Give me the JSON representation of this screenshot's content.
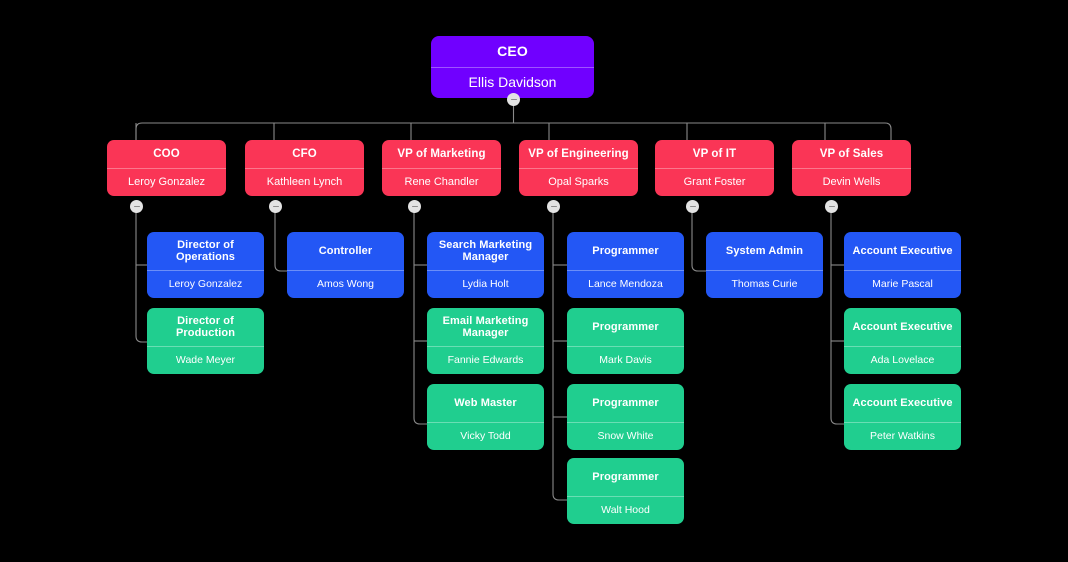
{
  "org_chart": {
    "background_color": "#000000",
    "colors": {
      "ceo": "#7000ff",
      "executive": "#fa3556",
      "report_blue": "#2357f5",
      "report_green": "#20ce8f",
      "connector": "#8a8a8a",
      "toggle": "#e3e3e3"
    },
    "nodes": [
      {
        "id": "ceo",
        "title": "CEO",
        "person": "Ellis Davidson"
      },
      {
        "id": "coo",
        "title": "COO",
        "person": "Leroy Gonzalez"
      },
      {
        "id": "cfo",
        "title": "CFO",
        "person": "Kathleen Lynch"
      },
      {
        "id": "vpm",
        "title": "VP of Marketing",
        "person": "Rene Chandler"
      },
      {
        "id": "vpe",
        "title": "VP of Engineering",
        "person": "Opal Sparks"
      },
      {
        "id": "vpit",
        "title": "VP of IT",
        "person": "Grant Foster"
      },
      {
        "id": "vps",
        "title": "VP of Sales",
        "person": "Devin Wells"
      },
      {
        "id": "dirops",
        "title": "Director of Operations",
        "person": "Leroy Gonzalez"
      },
      {
        "id": "dirprod",
        "title": "Director of Production",
        "person": "Wade Meyer"
      },
      {
        "id": "ctrl",
        "title": "Controller",
        "person": "Amos Wong"
      },
      {
        "id": "smm",
        "title": "Search Marketing Manager",
        "person": "Lydia Holt"
      },
      {
        "id": "emm",
        "title": "Email Marketing Manager",
        "person": "Fannie Edwards"
      },
      {
        "id": "webm",
        "title": "Web Master",
        "person": "Vicky Todd"
      },
      {
        "id": "prog1",
        "title": "Programmer",
        "person": "Lance Mendoza"
      },
      {
        "id": "prog2",
        "title": "Programmer",
        "person": "Mark Davis"
      },
      {
        "id": "prog3",
        "title": "Programmer",
        "person": "Snow White"
      },
      {
        "id": "prog4",
        "title": "Programmer",
        "person": "Walt Hood"
      },
      {
        "id": "sysadmin",
        "title": "System Admin",
        "person": "Thomas Curie"
      },
      {
        "id": "ae1",
        "title": "Account Executive",
        "person": "Marie Pascal"
      },
      {
        "id": "ae2",
        "title": "Account Executive",
        "person": "Ada Lovelace"
      },
      {
        "id": "ae3",
        "title": "Account Executive",
        "person": "Peter Watkins"
      }
    ],
    "toggles": [
      {
        "id": "toggle-ceo",
        "parent": "ceo"
      },
      {
        "id": "toggle-coo",
        "parent": "coo"
      },
      {
        "id": "toggle-cfo",
        "parent": "cfo"
      },
      {
        "id": "toggle-vpm",
        "parent": "vpm"
      },
      {
        "id": "toggle-vpe",
        "parent": "vpe"
      },
      {
        "id": "toggle-vpit",
        "parent": "vpit"
      },
      {
        "id": "toggle-vps",
        "parent": "vps"
      }
    ]
  }
}
